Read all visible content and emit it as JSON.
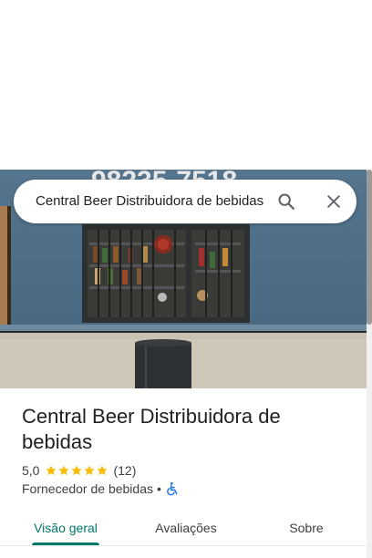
{
  "search": {
    "query": "Central Beer Distribuidora de bebidas"
  },
  "hero": {
    "storefront_sign": "98235-7518"
  },
  "place": {
    "name": "Central Beer Distribuidora de bebidas",
    "rating": "5,0",
    "star_count": 5,
    "review_count": "(12)",
    "category": "Fornecedor de bebidas",
    "separator": "•"
  },
  "tabs": [
    {
      "label": "Visão geral",
      "active": true
    },
    {
      "label": "Avaliações",
      "active": false
    },
    {
      "label": "Sobre",
      "active": false
    }
  ],
  "colors": {
    "accent": "#00796b",
    "star": "#fbbc04",
    "accessibility": "#1a73e8",
    "wall": "#4d6f8a"
  },
  "icons": {
    "search": "search-icon",
    "close": "close-icon",
    "accessibility": "wheelchair-icon",
    "star": "star-icon"
  }
}
